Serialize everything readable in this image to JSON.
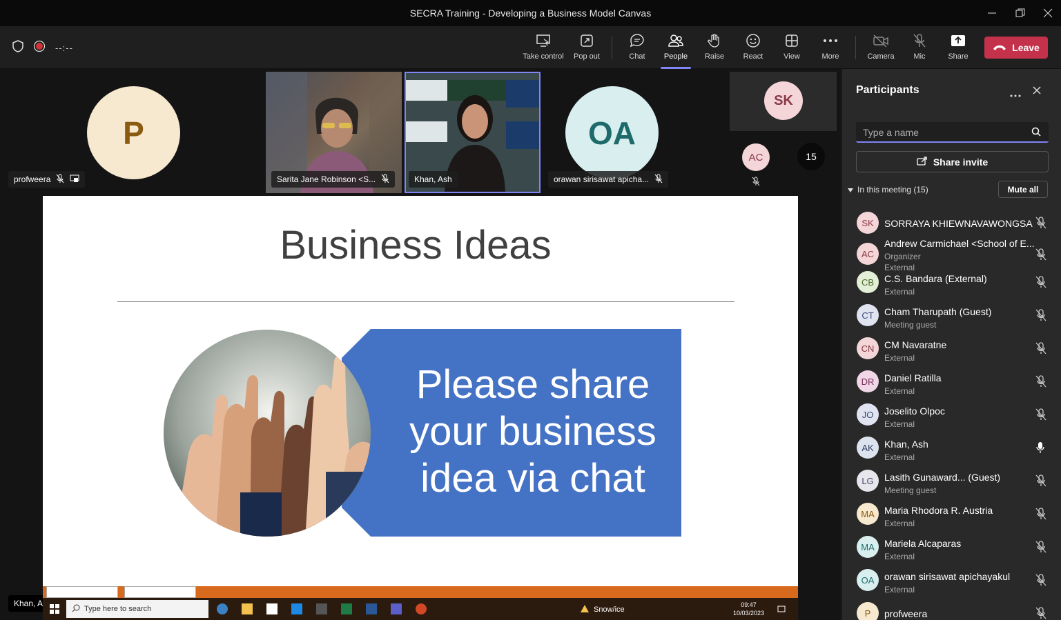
{
  "window": {
    "title": "SECRA Training - Developing a Business Model Canvas"
  },
  "toolbar": {
    "timer": "--:--",
    "buttons": {
      "take_control": "Take control",
      "pop_out": "Pop out",
      "chat": "Chat",
      "people": "People",
      "raise": "Raise",
      "react": "React",
      "view": "View",
      "more": "More",
      "camera": "Camera",
      "mic": "Mic",
      "share": "Share"
    },
    "leave_label": "Leave",
    "active_tab": "People"
  },
  "stage": {
    "tiles": [
      {
        "initials": "P",
        "name": "profweera",
        "avatar_bg": "#f7e9cf",
        "avatar_fg": "#8a5a10"
      },
      {
        "name": "Sarita Jane Robinson <S..."
      },
      {
        "name": "Khan, Ash"
      },
      {
        "initials": "OA",
        "name": "orawan sirisawat apicha...",
        "avatar_bg": "#d9efef",
        "avatar_fg": "#1f6b6b"
      }
    ],
    "overflow": {
      "sk": "SK",
      "ac": "AC",
      "count": "15"
    },
    "presenter_label": "Khan, Ash"
  },
  "slide": {
    "title": "Business Ideas",
    "banner_lines": [
      "Please share",
      "your business",
      "idea via chat"
    ],
    "banner_color": "#4472c4"
  },
  "taskbar": {
    "search_placeholder": "Type here to search",
    "weather": "Snow/ice",
    "time": "09:47",
    "date": "10/03/2023"
  },
  "panel": {
    "title": "Participants",
    "search_placeholder": "Type a name",
    "share_invite": "Share invite",
    "in_meeting": "In this meeting (15)",
    "mute_all": "Mute all",
    "participants": [
      {
        "initials": "SK",
        "name": "SORRAYA KHIEWNAVAWONGSA",
        "sub1": "",
        "sub2": "",
        "bg": "#f4d5d8",
        "fg": "#8b3a48",
        "mic": "muted"
      },
      {
        "initials": "AC",
        "name": "Andrew Carmichael <School of E...",
        "sub1": "Organizer",
        "sub2": "External",
        "bg": "#f4d5d8",
        "fg": "#8b3a48",
        "mic": "muted"
      },
      {
        "initials": "CB",
        "name": "C.S. Bandara (External)",
        "sub1": "External",
        "sub2": "",
        "bg": "#e3efd6",
        "fg": "#4a6b2a",
        "mic": "muted"
      },
      {
        "initials": "CT",
        "name": "Cham Tharupath (Guest)",
        "sub1": "Meeting guest",
        "sub2": "",
        "bg": "#e0e3f0",
        "fg": "#3d4a7a",
        "mic": "muted"
      },
      {
        "initials": "CN",
        "name": "CM Navaratne",
        "sub1": "External",
        "sub2": "",
        "bg": "#f4d5d8",
        "fg": "#8b3a48",
        "mic": "muted"
      },
      {
        "initials": "DR",
        "name": "Daniel Ratilla",
        "sub1": "External",
        "sub2": "",
        "bg": "#f0d6e6",
        "fg": "#7a2e5a",
        "mic": "muted"
      },
      {
        "initials": "JO",
        "name": "Joselito Olpoc",
        "sub1": "External",
        "sub2": "",
        "bg": "#e0e3f0",
        "fg": "#3d4a7a",
        "mic": "muted"
      },
      {
        "initials": "AK",
        "name": "Khan, Ash",
        "sub1": "External",
        "sub2": "",
        "bg": "#dde3ee",
        "fg": "#2e3e63",
        "mic": "on"
      },
      {
        "initials": "LG",
        "name": "Lasith Gunaward... (Guest)",
        "sub1": "Meeting guest",
        "sub2": "",
        "bg": "#e6e6ec",
        "fg": "#444c66",
        "mic": "muted"
      },
      {
        "initials": "MA",
        "name": "Maria Rhodora R. Austria",
        "sub1": "External",
        "sub2": "",
        "bg": "#f7e9cf",
        "fg": "#8a5a10",
        "mic": "muted"
      },
      {
        "initials": "MA",
        "name": "Mariela Alcaparas",
        "sub1": "External",
        "sub2": "",
        "bg": "#d9efef",
        "fg": "#1f6b6b",
        "mic": "muted"
      },
      {
        "initials": "OA",
        "name": "orawan sirisawat apichayakul",
        "sub1": "External",
        "sub2": "",
        "bg": "#d9efef",
        "fg": "#1f6b6b",
        "mic": "muted"
      },
      {
        "initials": "P",
        "name": "profweera",
        "sub1": "",
        "sub2": "",
        "bg": "#f7e9cf",
        "fg": "#8a5a10",
        "mic": "muted"
      }
    ]
  }
}
